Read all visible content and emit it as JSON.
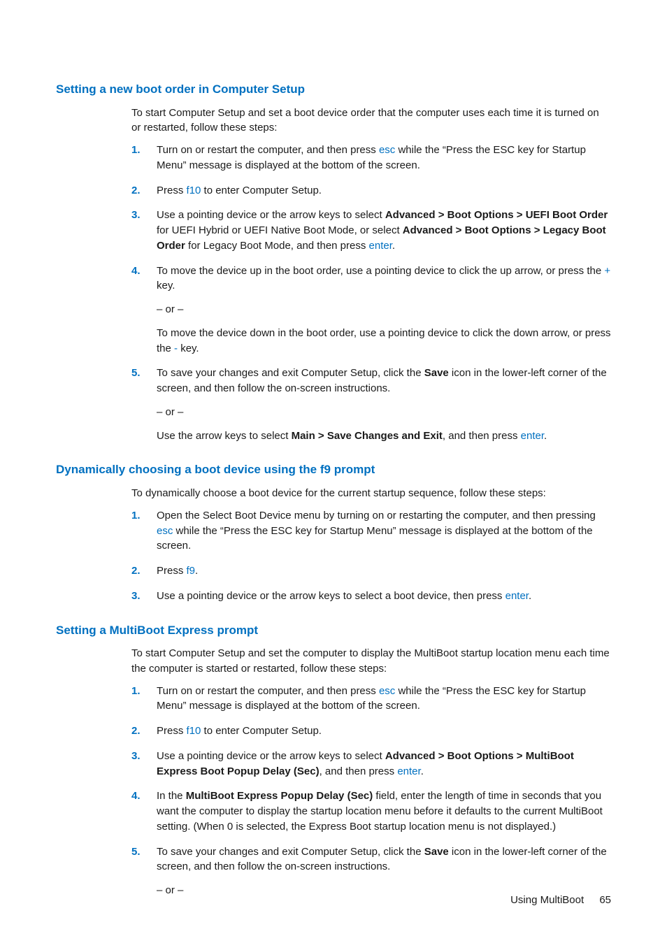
{
  "section1": {
    "title": "Setting a new boot order in Computer Setup",
    "intro": "To start Computer Setup and set a boot device order that the computer uses each time it is turned on or restarted, follow these steps:",
    "s1a": "Turn on or restart the computer, and then press ",
    "s1_esc": "esc",
    "s1b": " while the “Press the ESC key for Startup Menu” message is displayed at the bottom of the screen.",
    "s2a": "Press ",
    "s2_f10": "f10",
    "s2b": " to enter Computer Setup.",
    "s3a": "Use a pointing device or the arrow keys to select ",
    "s3_bold1": "Advanced > Boot Options > UEFI Boot Order",
    "s3b": " for UEFI Hybrid or UEFI Native Boot Mode, or select ",
    "s3_bold2": "Advanced > Boot Options > Legacy Boot Order",
    "s3c": " for Legacy Boot Mode, and then press ",
    "s3_enter": "enter",
    "s3d": ".",
    "s4p1a": "To move the device up in the boot order, use a pointing device to click the up arrow, or press the ",
    "s4_plus": "+",
    "s4p1b": " key.",
    "s4p2": "– or –",
    "s4p3a": "To move the device down in the boot order, use a pointing device to click the down arrow, or press the ",
    "s4_minus": "-",
    "s4p3b": " key.",
    "s5p1a": "To save your changes and exit Computer Setup, click the ",
    "s5_save": "Save",
    "s5p1b": " icon in the lower-left corner of the screen, and then follow the on-screen instructions.",
    "s5p2": "– or –",
    "s5p3a": "Use the arrow keys to select ",
    "s5_bold": "Main > Save Changes and Exit",
    "s5p3b": ", and then press ",
    "s5_enter": "enter",
    "s5p3c": "."
  },
  "section2": {
    "title": "Dynamically choosing a boot device using the f9 prompt",
    "intro": "To dynamically choose a boot device for the current startup sequence, follow these steps:",
    "s1a": "Open the Select Boot Device menu by turning on or restarting the computer, and then pressing ",
    "s1_esc": "esc",
    "s1b": " while the “Press the ESC key for Startup Menu” message is displayed at the bottom of the screen.",
    "s2a": "Press ",
    "s2_f9": "f9",
    "s2b": ".",
    "s3a": "Use a pointing device or the arrow keys to select a boot device, then press ",
    "s3_enter": "enter",
    "s3b": "."
  },
  "section3": {
    "title": "Setting a MultiBoot Express prompt",
    "intro": "To start Computer Setup and set the computer to display the MultiBoot startup location menu each time the computer is started or restarted, follow these steps:",
    "s1a": "Turn on or restart the computer, and then press ",
    "s1_esc": "esc",
    "s1b": " while the “Press the ESC key for Startup Menu” message is displayed at the bottom of the screen.",
    "s2a": "Press ",
    "s2_f10": "f10",
    "s2b": " to enter Computer Setup.",
    "s3a": "Use a pointing device or the arrow keys to select ",
    "s3_bold": "Advanced > Boot Options > MultiBoot Express Boot Popup Delay (Sec)",
    "s3b": ", and then press ",
    "s3_enter": "enter",
    "s3c": ".",
    "s4a": "In the ",
    "s4_bold": "MultiBoot Express Popup Delay (Sec)",
    "s4b": " field, enter the length of time in seconds that you want the computer to display the startup location menu before it defaults to the current MultiBoot setting. (When 0 is selected, the Express Boot startup location menu is not displayed.)",
    "s5p1a": "To save your changes and exit Computer Setup, click the ",
    "s5_save": "Save",
    "s5p1b": " icon in the lower-left corner of the screen, and then follow the on-screen instructions.",
    "s5p2": "– or –"
  },
  "footer": {
    "label": "Using MultiBoot",
    "page": "65"
  }
}
